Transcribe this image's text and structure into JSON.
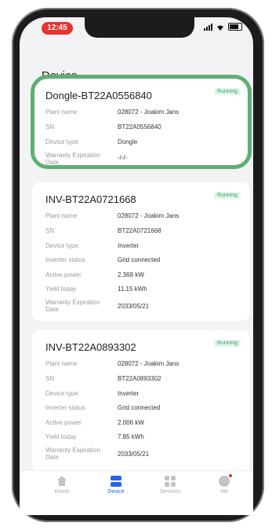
{
  "status_bar": {
    "time": "12:45"
  },
  "page_title": "Device",
  "cards": [
    {
      "title": "Dongle-BT22A0556840",
      "status": "Running",
      "rows": [
        {
          "label": "Plant name",
          "value": "028072 - Joakim Jans"
        },
        {
          "label": "SN",
          "value": "BT22A0556840"
        },
        {
          "label": "Device type",
          "value": "Dongle"
        },
        {
          "label": "Warranty Expiration Date",
          "value": "-/-/-"
        }
      ]
    },
    {
      "title": "INV-BT22A0721668",
      "status": "Running",
      "rows": [
        {
          "label": "Plant name",
          "value": "028072 - Joakim Jans"
        },
        {
          "label": "SN",
          "value": "BT22A0721668"
        },
        {
          "label": "Device type",
          "value": "Inverter"
        },
        {
          "label": "Inverter status",
          "value": "Grid connected"
        },
        {
          "label": "Active power",
          "value": "2.368 kW"
        },
        {
          "label": "Yield today",
          "value": "11.15 kWh"
        },
        {
          "label": "Warranty Expiration Date",
          "value": "2033/05/21"
        }
      ]
    },
    {
      "title": "INV-BT22A0893302",
      "status": "Running",
      "rows": [
        {
          "label": "Plant name",
          "value": "028072 - Joakim Jans"
        },
        {
          "label": "SN",
          "value": "BT22A0893302"
        },
        {
          "label": "Device type",
          "value": "Inverter"
        },
        {
          "label": "Inverter status",
          "value": "Grid connected"
        },
        {
          "label": "Active power",
          "value": "2.006 kW"
        },
        {
          "label": "Yield today",
          "value": "7.85 kWh"
        },
        {
          "label": "Warranty Expiration Date",
          "value": "2033/05/21"
        }
      ]
    }
  ],
  "tabbar": {
    "home": "Home",
    "device": "Device",
    "services": "Services",
    "me": "Me"
  },
  "colors": {
    "accent": "#2563eb",
    "running": "#3aa36b",
    "highlight": "#5bb072",
    "time_pill": "#e8322f"
  }
}
